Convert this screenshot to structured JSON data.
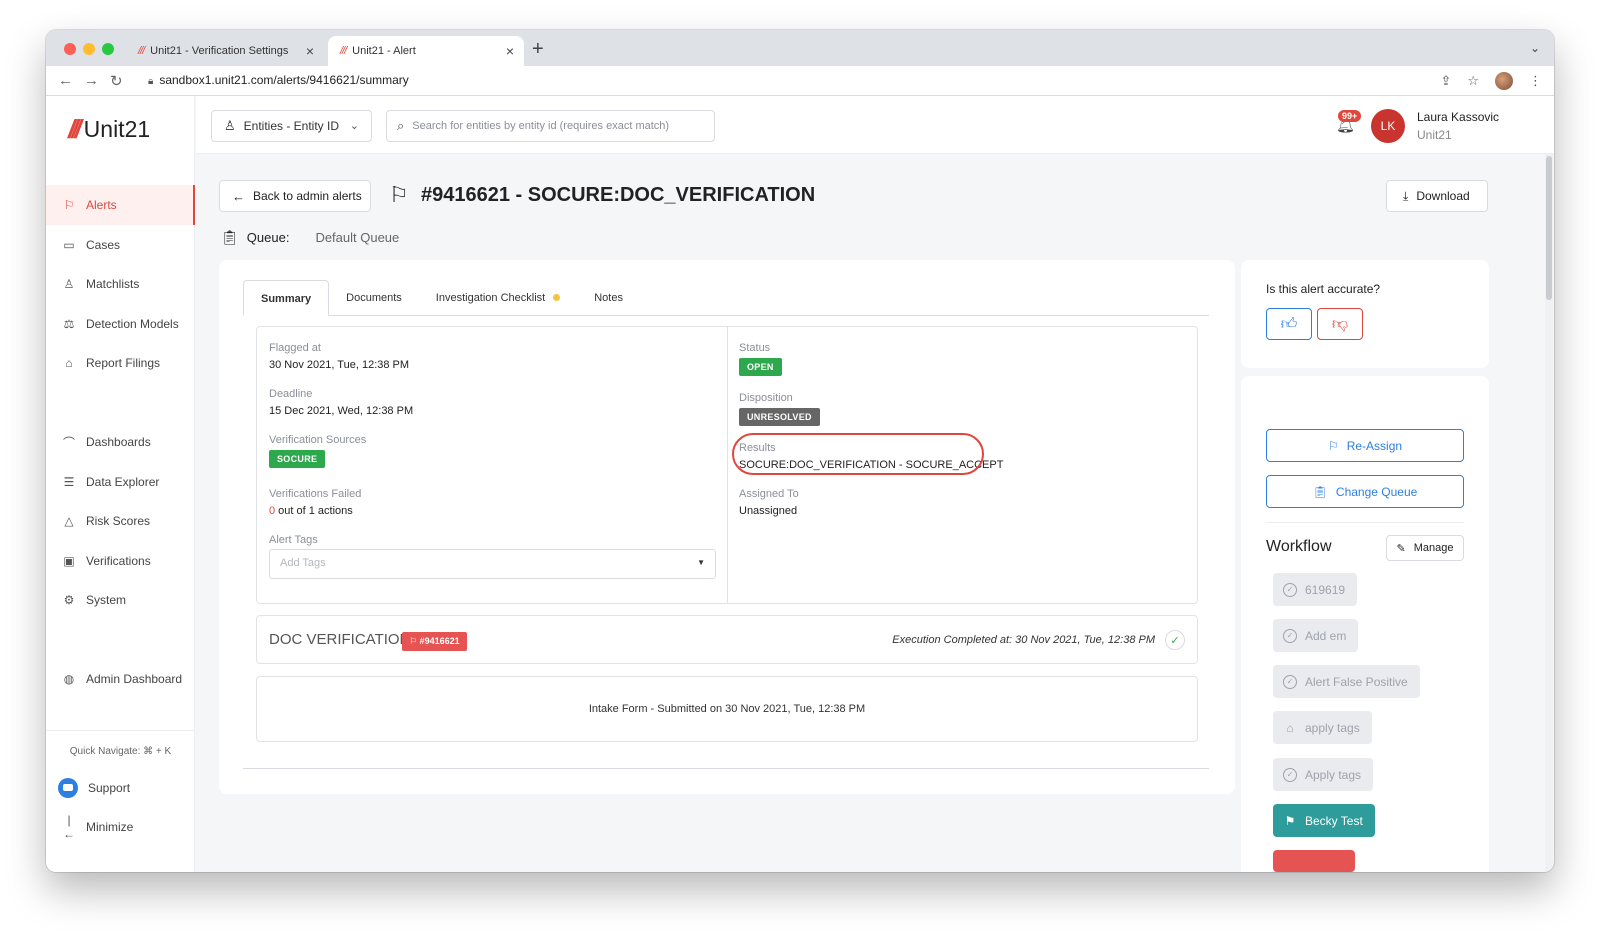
{
  "browser": {
    "tabs": [
      {
        "label": "Unit21 - Verification Settings",
        "favicon": "///"
      },
      {
        "label": "Unit21 - Alert",
        "favicon": "///"
      }
    ],
    "close_glyph": "×",
    "new_tab_glyph": "+",
    "url": "sandbox1.unit21.com/alerts/9416621/summary"
  },
  "sidebar": {
    "logo": "Unit21",
    "logo_mark": "///",
    "items": [
      {
        "label": "Alerts",
        "icon": "flag-icon"
      },
      {
        "label": "Cases",
        "icon": "briefcase-icon"
      },
      {
        "label": "Matchlists",
        "icon": "person-list-icon"
      },
      {
        "label": "Detection Models",
        "icon": "scale-icon"
      },
      {
        "label": "Report Filings",
        "icon": "building-icon"
      },
      {
        "label": "Dashboards",
        "icon": "chart-icon"
      },
      {
        "label": "Data Explorer",
        "icon": "search-list-icon"
      },
      {
        "label": "Risk Scores",
        "icon": "warning-icon"
      },
      {
        "label": "Verifications",
        "icon": "id-card-icon"
      },
      {
        "label": "System",
        "icon": "gear-icon"
      },
      {
        "label": "Admin Dashboard",
        "icon": "globe-icon"
      }
    ],
    "quick_navigate": "Quick Navigate: ⌘ + K",
    "support": "Support",
    "minimize": "Minimize"
  },
  "topbar": {
    "entity_select": "Entities - Entity ID",
    "search_placeholder": "Search for entities by entity id (requires exact match)",
    "notification_count": "99+",
    "user_initials": "LK",
    "user_name": "Laura Kassovic",
    "user_org": "Unit21"
  },
  "header": {
    "back_label": "Back to admin alerts",
    "title": "#9416621 - SOCURE:DOC_VERIFICATION",
    "download_label": "Download",
    "queue_label": "Queue:",
    "queue_value": "Default Queue"
  },
  "tabs": [
    {
      "label": "Summary",
      "active": true
    },
    {
      "label": "Documents",
      "active": false
    },
    {
      "label": "Investigation Checklist",
      "active": false,
      "indicator_color": "#f6c342"
    },
    {
      "label": "Notes",
      "active": false
    }
  ],
  "summary": {
    "left": {
      "flagged_at_label": "Flagged at",
      "flagged_at_value": "30 Nov 2021, Tue, 12:38 PM",
      "deadline_label": "Deadline",
      "deadline_value": "15 Dec 2021, Wed, 12:38 PM",
      "sources_label": "Verification Sources",
      "sources_badge": "SOCURE",
      "failed_label": "Verifications Failed",
      "failed_count": "0",
      "failed_rest": " out of 1 actions",
      "tags_label": "Alert Tags",
      "tags_placeholder": "Add Tags"
    },
    "right": {
      "status_label": "Status",
      "status_badge": "OPEN",
      "disposition_label": "Disposition",
      "disposition_badge": "UNRESOLVED",
      "results_label": "Results",
      "results_value": "SOCURE:DOC_VERIFICATION - SOCURE_ACCEPT",
      "assigned_label": "Assigned To",
      "assigned_value": "Unassigned"
    }
  },
  "doc_verification": {
    "title": "DOC VERIFICATION",
    "badge": "#9416621",
    "execution": "Execution Completed at: 30 Nov 2021, Tue, 12:38 PM"
  },
  "intake": {
    "text": "Intake Form - Submitted on 30 Nov 2021, Tue, 12:38 PM"
  },
  "right_panel": {
    "accuracy_question": "Is this alert accurate?",
    "reassign_label": "Re-Assign",
    "change_queue_label": "Change Queue",
    "workflow_title": "Workflow",
    "manage_label": "Manage",
    "workflow_buttons": [
      {
        "label": "619619",
        "active": false
      },
      {
        "label": "Add em",
        "active": false
      },
      {
        "label": "Alert False Positive",
        "active": false
      },
      {
        "label": "apply tags",
        "active": false,
        "icon": "tag-icon"
      },
      {
        "label": "Apply tags",
        "active": false
      },
      {
        "label": "Becky Test",
        "active": true
      }
    ]
  },
  "colors": {
    "brand_red": "#e0463b",
    "primary_blue": "#2d7fe0",
    "success_green": "#2ea84d",
    "teal": "#2f9c9c"
  }
}
